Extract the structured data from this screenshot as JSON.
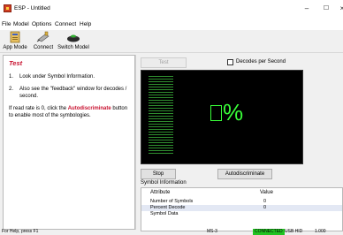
{
  "window": {
    "title": "ESP - Untitled",
    "controls": {
      "minimize": "–",
      "maximize": "☐",
      "close": "×"
    }
  },
  "menu": [
    "File",
    "Model",
    "Options",
    "Connect",
    "Help"
  ],
  "toolbar": {
    "app_mode": "App Mode",
    "connect": "Connect",
    "switch_model": "Switch Model"
  },
  "instructions": {
    "title": "Test",
    "steps": [
      {
        "num": "1.",
        "text": "Look under Symbol Information."
      },
      {
        "num": "2.",
        "text": "Also see the \"feedback\" window for decodes / second."
      }
    ],
    "note_before": "If read rate is 0, click the ",
    "note_highlight": "Autodiscriminate",
    "note_after": " button to enable most of the symbologies."
  },
  "test_panel": {
    "test_button": "Test",
    "decodes_checkbox": "Decodes per Second",
    "decodes_checked": false,
    "display_value": "%",
    "stop_button": "Stop",
    "autodiscriminate_button": "Autodiscriminate",
    "colors": {
      "display_text": "#39ff39",
      "level_bars": "#2f8f2f",
      "display_bg": "#000000"
    }
  },
  "symbol_info": {
    "label": "Symbol Information",
    "columns": [
      "Attribute",
      "Value"
    ],
    "rows": [
      {
        "attribute": "Number of Symbols",
        "value": "0"
      },
      {
        "attribute": "Percent Decode",
        "value": "0"
      },
      {
        "attribute": "Symbol Data",
        "value": ""
      }
    ]
  },
  "statusbar": {
    "help": "For Help, press F1",
    "model": "MS-3",
    "connection": "CONNECTED",
    "port": "USB HID",
    "version": "1.000",
    "colors": {
      "connected_bg": "#22c322"
    }
  }
}
